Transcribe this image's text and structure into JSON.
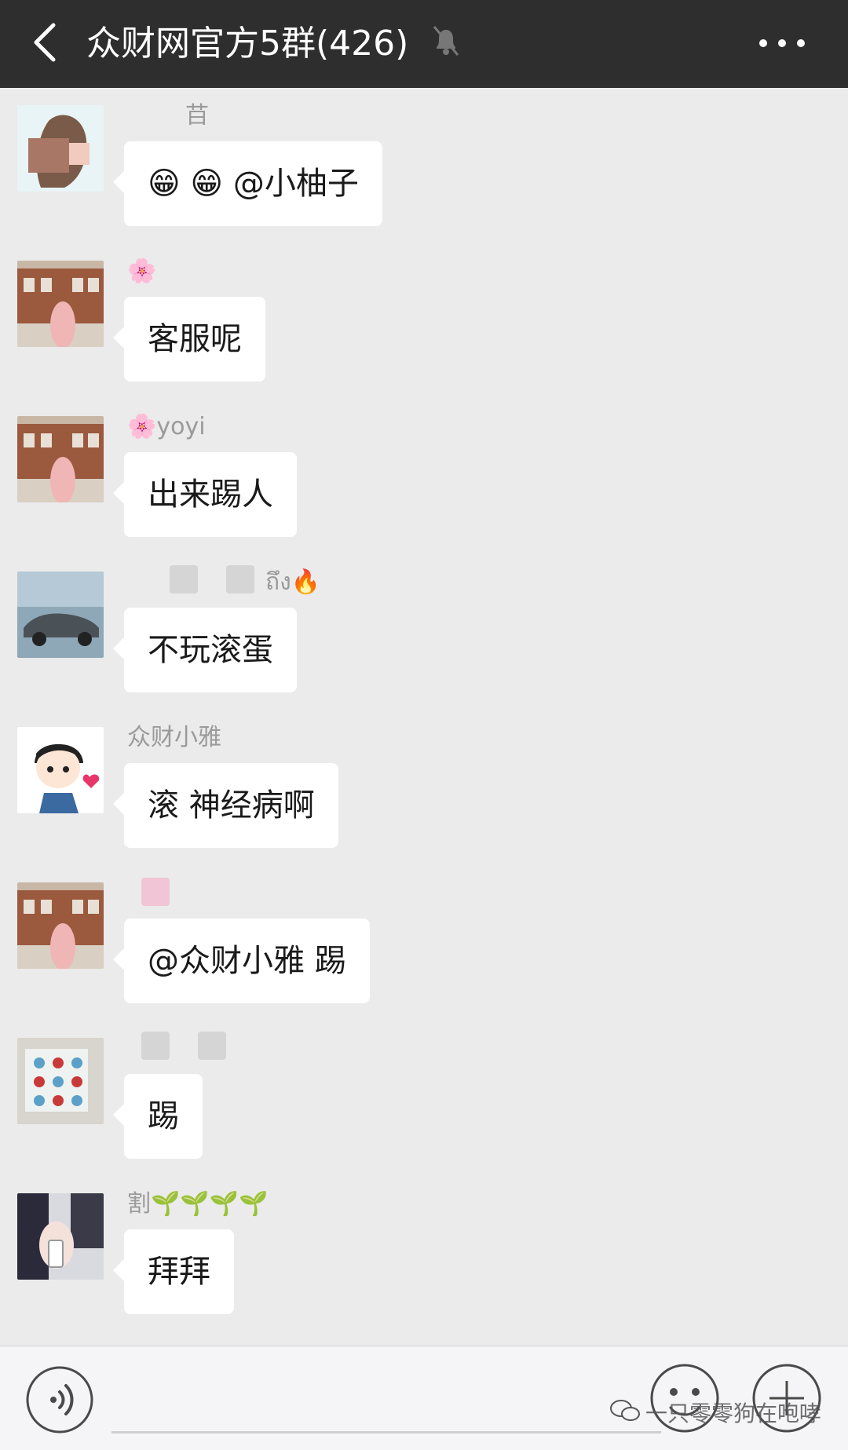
{
  "header": {
    "title": "众财网官方5群(426)",
    "back_icon": "back-chevron-icon",
    "mute_icon": "bell-muted-icon",
    "more_icon": "more-dots-icon",
    "background": "#2e2e2e"
  },
  "messages": [
    {
      "sender": "䒤",
      "text": "😁 😁 @小柚子",
      "avatar": "avatar-woman-icon"
    },
    {
      "sender": "🌸",
      "text": "客服呢",
      "avatar": "avatar-building-icon"
    },
    {
      "sender": "🌸yoyi",
      "text": "出来踢人",
      "avatar": "avatar-building-icon"
    },
    {
      "sender": "ถึง🔥",
      "text": "不玩滚蛋",
      "avatar": "avatar-car-icon"
    },
    {
      "sender": "众财小雅",
      "text": "滚 神经病啊",
      "avatar": "avatar-cartoon-girl-icon"
    },
    {
      "sender": "",
      "text": "@众财小雅  踢",
      "avatar": "avatar-building-icon"
    },
    {
      "sender": "",
      "text": "踢",
      "avatar": "avatar-tiles-icon"
    },
    {
      "sender": "割🌱🌱🌱🌱",
      "text": "拜拜",
      "avatar": "avatar-phone-hand-icon"
    }
  ],
  "input_bar": {
    "voice_icon": "voice-icon",
    "emoji_icon": "emoji-icon",
    "plus_icon": "plus-icon",
    "watermark": "一只零零狗在咆哮"
  },
  "colors": {
    "chat_background": "#ebebeb",
    "bubble": "#ffffff",
    "sender_text": "#9a9a9a"
  }
}
